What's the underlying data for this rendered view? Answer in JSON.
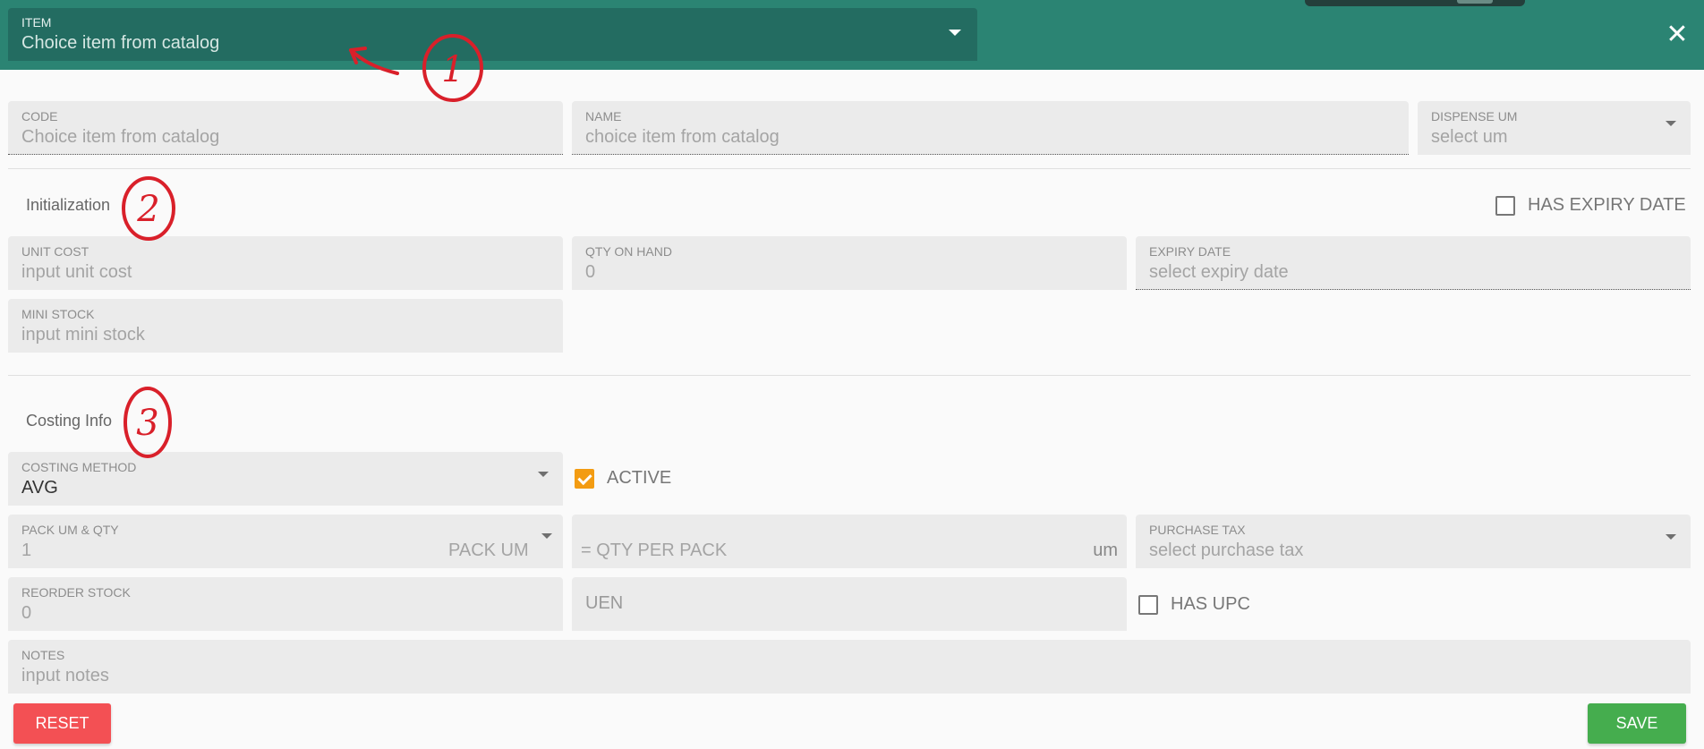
{
  "header": {
    "item_label": "ITEM",
    "item_value": "Choice item from catalog",
    "close_symbol": "✕"
  },
  "fields": {
    "code": {
      "label": "CODE",
      "placeholder": "Choice item from catalog"
    },
    "name": {
      "label": "NAME",
      "placeholder": "choice item from catalog"
    },
    "dispense_um": {
      "label": "DISPENSE UM",
      "placeholder": "select um"
    },
    "unit_cost": {
      "label": "UNIT COST",
      "placeholder": "input unit cost"
    },
    "qty_on_hand": {
      "label": "QTY ON HAND",
      "value": "0"
    },
    "expiry_date": {
      "label": "EXPIRY DATE",
      "placeholder": "select expiry date"
    },
    "mini_stock": {
      "label": "MINI STOCK",
      "placeholder": "input mini stock"
    },
    "costing_method": {
      "label": "COSTING METHOD",
      "value": "AVG"
    },
    "pack_um_qty": {
      "label": "PACK UM & QTY",
      "value": "1",
      "pack_um_placeholder": "PACK UM"
    },
    "qty_per_pack": {
      "placeholder": "= QTY PER PACK",
      "suffix": "um"
    },
    "purchase_tax": {
      "label": "PURCHASE TAX",
      "placeholder": "select purchase tax"
    },
    "reorder_stock": {
      "label": "REORDER STOCK",
      "value": "0"
    },
    "uen": {
      "placeholder": "UEN"
    },
    "notes": {
      "label": "NOTES",
      "placeholder": "input notes"
    }
  },
  "sections": {
    "initialization": "Initialization",
    "costing_info": "Costing Info"
  },
  "checkboxes": {
    "has_expiry_date": {
      "label": "HAS EXPIRY DATE",
      "checked": false
    },
    "active": {
      "label": "ACTIVE",
      "checked": true
    },
    "has_upc": {
      "label": "HAS UPC",
      "checked": false
    }
  },
  "buttons": {
    "reset": "RESET",
    "save": "SAVE"
  },
  "annotations": {
    "numbers": [
      "1",
      "2",
      "3"
    ]
  },
  "colors": {
    "header_bg": "#2b8473",
    "item_select_bg": "#236c61",
    "reset": "#f35054",
    "save": "#45ad4e",
    "checkbox_checked": "#f39c12",
    "annotation": "#d9202a"
  }
}
